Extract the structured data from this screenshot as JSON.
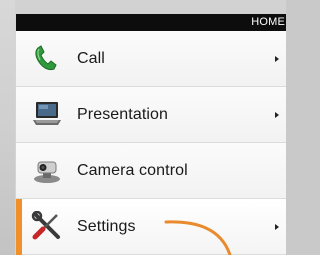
{
  "header": {
    "title": "HOME"
  },
  "menu": {
    "items": [
      {
        "label": "Call",
        "icon": "phone-handset-icon",
        "has_submenu": true,
        "selected": false
      },
      {
        "label": "Presentation",
        "icon": "laptop-icon",
        "has_submenu": true,
        "selected": false
      },
      {
        "label": "Camera control",
        "icon": "camera-icon",
        "has_submenu": false,
        "selected": false
      },
      {
        "label": "Settings",
        "icon": "wrench-screwdriver-icon",
        "has_submenu": true,
        "selected": true
      }
    ]
  },
  "colors": {
    "accent": "#f0902a",
    "header_bg": "#0d0d0d",
    "header_text": "#ffffff",
    "panel_bg": "#f6f6f6",
    "call_icon": "#2e9a3c"
  }
}
